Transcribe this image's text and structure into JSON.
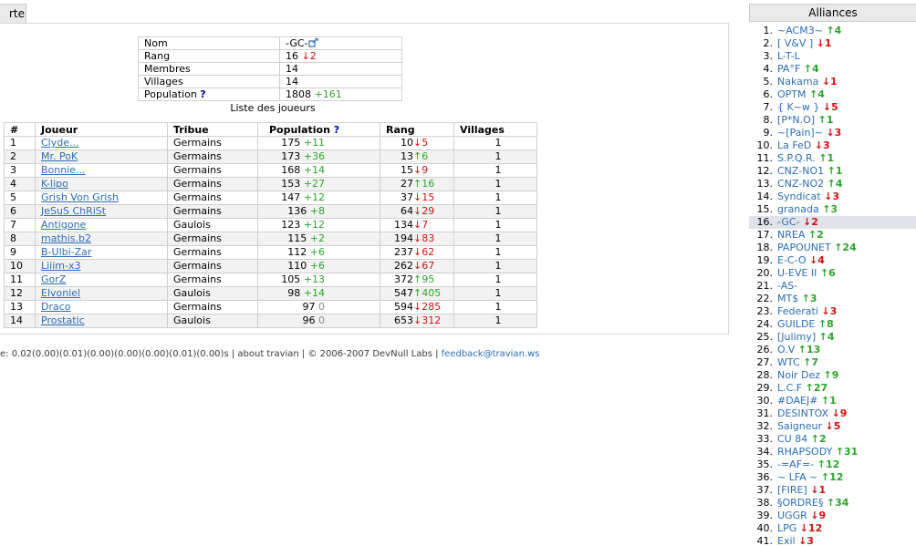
{
  "tab_label": "rte",
  "info": {
    "rows": [
      {
        "key": "Nom",
        "value": "-GC-",
        "icon": "external-link-icon"
      },
      {
        "key": "Rang",
        "value": "16",
        "delta": "↓2",
        "trend": "down"
      },
      {
        "key": "Membres",
        "value": "14"
      },
      {
        "key": "Villages",
        "value": "14"
      },
      {
        "key": "Population",
        "help": "?",
        "value": "1808",
        "delta": "+161",
        "trend": "up"
      }
    ]
  },
  "players_title": "Liste des joueurs",
  "players": {
    "headers": [
      "#",
      "Joueur",
      "Tribue",
      "Population",
      "Rang",
      "Villages"
    ],
    "population_help": "?",
    "rows": [
      {
        "n": "1",
        "name": "Clyde...",
        "tribe": "Germains",
        "pop": "175",
        "popd": "+11",
        "popt": "up",
        "rank": "10",
        "rankd": "↓5",
        "rankt": "down",
        "vil": "1"
      },
      {
        "n": "2",
        "name": "Mr. PoK",
        "tribe": "Germains",
        "pop": "173",
        "popd": "+36",
        "popt": "up",
        "rank": "13",
        "rankd": "↑6",
        "rankt": "up",
        "vil": "1"
      },
      {
        "n": "3",
        "name": "Bonnie...",
        "tribe": "Germains",
        "pop": "168",
        "popd": "+14",
        "popt": "up",
        "rank": "15",
        "rankd": "↓9",
        "rankt": "down",
        "vil": "1"
      },
      {
        "n": "4",
        "name": "K-lipo",
        "tribe": "Germains",
        "pop": "153",
        "popd": "+27",
        "popt": "up",
        "rank": "27",
        "rankd": "↑16",
        "rankt": "up",
        "vil": "1"
      },
      {
        "n": "5",
        "name": "Grish Von Grish",
        "tribe": "Germains",
        "pop": "147",
        "popd": "+12",
        "popt": "up",
        "rank": "37",
        "rankd": "↓15",
        "rankt": "down",
        "vil": "1"
      },
      {
        "n": "6",
        "name": "JeSuS ChRiSt",
        "tribe": "Germains",
        "pop": "136",
        "popd": "+8",
        "popt": "up",
        "rank": "64",
        "rankd": "↓29",
        "rankt": "down",
        "vil": "1"
      },
      {
        "n": "7",
        "name": "Antigone",
        "tribe": "Gaulois",
        "pop": "123",
        "popd": "+12",
        "popt": "up",
        "rank": "134",
        "rankd": "↓7",
        "rankt": "down",
        "vil": "1"
      },
      {
        "n": "8",
        "name": "mathis.b2",
        "tribe": "Germains",
        "pop": "115",
        "popd": "+2",
        "popt": "up",
        "rank": "194",
        "rankd": "↓83",
        "rankt": "down",
        "vil": "1"
      },
      {
        "n": "9",
        "name": "B-Ulbi-Zar",
        "tribe": "Germains",
        "pop": "112",
        "popd": "+6",
        "popt": "up",
        "rank": "237",
        "rankd": "↓62",
        "rankt": "down",
        "vil": "1"
      },
      {
        "n": "10",
        "name": "Liiim-x3",
        "tribe": "Germains",
        "pop": "110",
        "popd": "+6",
        "popt": "up",
        "rank": "262",
        "rankd": "↓67",
        "rankt": "down",
        "vil": "1"
      },
      {
        "n": "11",
        "name": "GorZ",
        "tribe": "Germains",
        "pop": "105",
        "popd": "+13",
        "popt": "up",
        "rank": "372",
        "rankd": "↑95",
        "rankt": "up",
        "vil": "1"
      },
      {
        "n": "12",
        "name": "Elvoniel",
        "tribe": "Gaulois",
        "pop": "98",
        "popd": "+14",
        "popt": "up",
        "rank": "547",
        "rankd": "↑405",
        "rankt": "up",
        "vil": "1"
      },
      {
        "n": "13",
        "name": "Draco",
        "tribe": "Germains",
        "pop": "97",
        "popd": "0",
        "popt": "zero",
        "rank": "594",
        "rankd": "↓285",
        "rankt": "down",
        "vil": "1"
      },
      {
        "n": "14",
        "name": "Prostatic",
        "tribe": "Gaulois",
        "pop": "96",
        "popd": "0",
        "popt": "zero",
        "rank": "653",
        "rankd": "↓312",
        "rankt": "down",
        "vil": "1"
      }
    ]
  },
  "footer": {
    "text": "e: 0.02(0.00)(0.01)(0.00)(0.00)(0.00)(0.01)(0.00)s | about travian | © 2006-2007 DevNull Labs | ",
    "link": "feedback@travian.ws"
  },
  "sidebar": {
    "title": "Alliances",
    "selected_index": 15,
    "items": [
      {
        "rank": "1.",
        "name": "~ACM3~",
        "delta": "↑4",
        "trend": "up"
      },
      {
        "rank": "2.",
        "name": "[ V&V ]",
        "delta": "↓1",
        "trend": "down"
      },
      {
        "rank": "3.",
        "name": "L-T-L",
        "delta": "",
        "trend": ""
      },
      {
        "rank": "4.",
        "name": "PA°F",
        "delta": "↑4",
        "trend": "up"
      },
      {
        "rank": "5.",
        "name": "Nakama",
        "delta": "↓1",
        "trend": "down"
      },
      {
        "rank": "6.",
        "name": "OPTM",
        "delta": "↑4",
        "trend": "up"
      },
      {
        "rank": "7.",
        "name": "{ K~w }",
        "delta": "↓5",
        "trend": "down"
      },
      {
        "rank": "8.",
        "name": "[P*N.O]",
        "delta": "↑1",
        "trend": "up"
      },
      {
        "rank": "9.",
        "name": "~[Pain]~",
        "delta": "↓3",
        "trend": "down"
      },
      {
        "rank": "10.",
        "name": "La FeD",
        "delta": "↓3",
        "trend": "down"
      },
      {
        "rank": "11.",
        "name": "S.P.Q.R.",
        "delta": "↑1",
        "trend": "up"
      },
      {
        "rank": "12.",
        "name": "CNZ-NO1",
        "delta": "↑1",
        "trend": "up"
      },
      {
        "rank": "13.",
        "name": "CNZ-NO2",
        "delta": "↑4",
        "trend": "up"
      },
      {
        "rank": "14.",
        "name": "Syndicat",
        "delta": "↓3",
        "trend": "down"
      },
      {
        "rank": "15.",
        "name": "granada",
        "delta": "↑3",
        "trend": "up"
      },
      {
        "rank": "16.",
        "name": "-GC-",
        "delta": "↓2",
        "trend": "down"
      },
      {
        "rank": "17.",
        "name": "NREA",
        "delta": "↑2",
        "trend": "up"
      },
      {
        "rank": "18.",
        "name": "PAPOUNET",
        "delta": "↑24",
        "trend": "up"
      },
      {
        "rank": "19.",
        "name": "E-C-O",
        "delta": "↓4",
        "trend": "down"
      },
      {
        "rank": "20.",
        "name": "U-EVE II",
        "delta": "↑6",
        "trend": "up"
      },
      {
        "rank": "21.",
        "name": "-AS-",
        "delta": "",
        "trend": ""
      },
      {
        "rank": "22.",
        "name": "MT$",
        "delta": "↑3",
        "trend": "up"
      },
      {
        "rank": "23.",
        "name": "Federati",
        "delta": "↓3",
        "trend": "down"
      },
      {
        "rank": "24.",
        "name": "GUILDE",
        "delta": "↑8",
        "trend": "up"
      },
      {
        "rank": "25.",
        "name": "[Julimy]",
        "delta": "↑4",
        "trend": "up"
      },
      {
        "rank": "26.",
        "name": "O.V",
        "delta": "↑13",
        "trend": "up"
      },
      {
        "rank": "27.",
        "name": "WTC",
        "delta": "↑7",
        "trend": "up"
      },
      {
        "rank": "28.",
        "name": "Noir Dez",
        "delta": "↑9",
        "trend": "up"
      },
      {
        "rank": "29.",
        "name": "L.C.F",
        "delta": "↑27",
        "trend": "up"
      },
      {
        "rank": "30.",
        "name": "#DAEJ#",
        "delta": "↑1",
        "trend": "up"
      },
      {
        "rank": "31.",
        "name": "DESINTOX",
        "delta": "↓9",
        "trend": "down"
      },
      {
        "rank": "32.",
        "name": "Saigneur",
        "delta": "↓5",
        "trend": "down"
      },
      {
        "rank": "33.",
        "name": "CU 84",
        "delta": "↑2",
        "trend": "up"
      },
      {
        "rank": "34.",
        "name": "RHAPSODY",
        "delta": "↑31",
        "trend": "up"
      },
      {
        "rank": "35.",
        "name": "-=AF=-",
        "delta": "↑12",
        "trend": "up"
      },
      {
        "rank": "36.",
        "name": "~ LFA ~",
        "delta": "↑12",
        "trend": "up"
      },
      {
        "rank": "37.",
        "name": "[FIRE]",
        "delta": "↓1",
        "trend": "down"
      },
      {
        "rank": "38.",
        "name": "§ORDRE§",
        "delta": "↑34",
        "trend": "up"
      },
      {
        "rank": "39.",
        "name": "UGGR",
        "delta": "↓9",
        "trend": "down"
      },
      {
        "rank": "40.",
        "name": "LPG",
        "delta": "↓12",
        "trend": "down"
      },
      {
        "rank": "41.",
        "name": "Exil",
        "delta": "↓3",
        "trend": "down"
      }
    ]
  }
}
